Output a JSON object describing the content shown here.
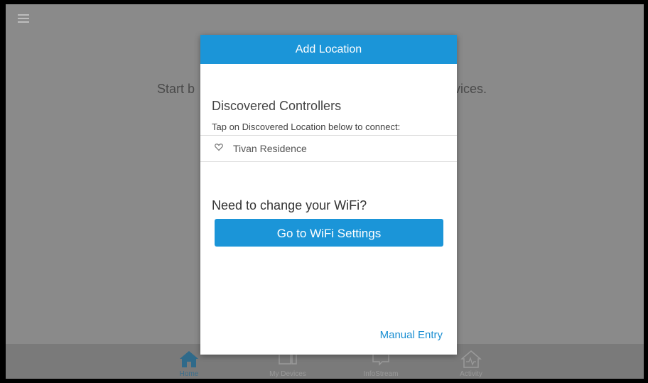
{
  "background": {
    "text_prefix": "Start b",
    "text_suffix": "vices."
  },
  "dialog": {
    "title": "Add Location",
    "section_title": "Discovered Controllers",
    "section_subtitle": "Tap on Discovered Location below to connect:",
    "locations": [
      {
        "icon": "heart-icon",
        "label": "Tivan Residence"
      }
    ],
    "wifi_prompt": "Need to change your WiFi?",
    "wifi_button": "Go to WiFi Settings",
    "manual_entry": "Manual Entry"
  },
  "bottom_nav": [
    {
      "label": "Home",
      "icon": "home-icon",
      "active": true
    },
    {
      "label": "My Devices",
      "icon": "devices-icon",
      "active": false
    },
    {
      "label": "InfoStream",
      "icon": "infostream-icon",
      "active": false
    },
    {
      "label": "Activity",
      "icon": "activity-icon",
      "active": false
    }
  ],
  "colors": {
    "accent": "#1b95d8",
    "overlay": "#8a8a8a",
    "link": "#1b8fd2"
  }
}
